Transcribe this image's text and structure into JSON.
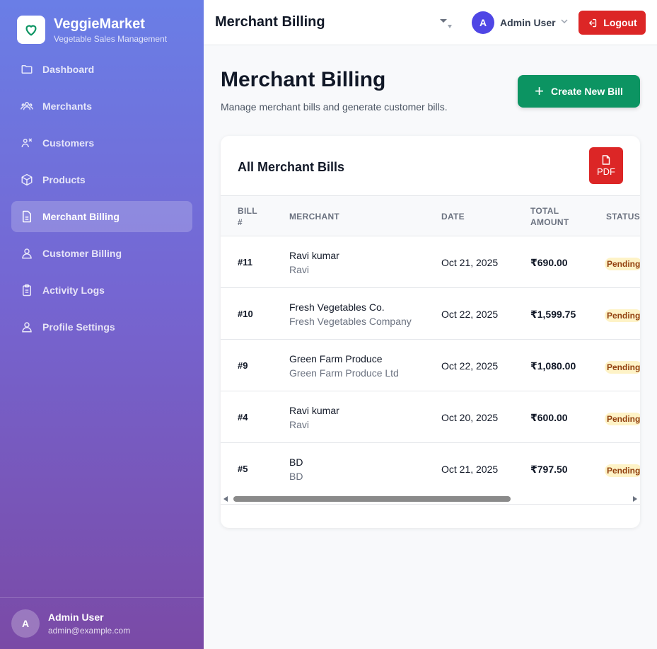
{
  "brand": {
    "name": "VeggieMarket",
    "subtitle": "Vegetable Sales Management"
  },
  "sidebar": {
    "items": [
      {
        "label": "Dashboard",
        "icon": "folder-icon"
      },
      {
        "label": "Merchants",
        "icon": "users-icon"
      },
      {
        "label": "Customers",
        "icon": "user-x-icon"
      },
      {
        "label": "Products",
        "icon": "box-icon"
      },
      {
        "label": "Merchant Billing",
        "icon": "document-icon",
        "active": true
      },
      {
        "label": "Customer Billing",
        "icon": "user-icon"
      },
      {
        "label": "Activity Logs",
        "icon": "clipboard-icon"
      },
      {
        "label": "Profile Settings",
        "icon": "user-icon"
      }
    ],
    "footer": {
      "avatar": "A",
      "name": "Admin User",
      "email": "admin@example.com"
    }
  },
  "topbar": {
    "title": "Merchant Billing",
    "user": {
      "avatar": "A",
      "name": "Admin User"
    },
    "logout_label": "Logout"
  },
  "page": {
    "title": "Merchant Billing",
    "subtitle": "Manage merchant bills and generate customer bills.",
    "create_label": "Create New Bill"
  },
  "table": {
    "title": "All Merchant Bills",
    "pdf_label": "PDF",
    "headers": {
      "bill_1": "BILL",
      "bill_2": "#",
      "merchant": "MERCHANT",
      "date": "DATE",
      "total_1": "TOTAL",
      "total_2": "AMOUNT",
      "status": "STATUS"
    },
    "rows": [
      {
        "bill": "#11",
        "merchant": "Ravi kumar",
        "merchant_sub": "Ravi",
        "date": "Oct 21, 2025",
        "amount": "₹690.00",
        "status": "Pending"
      },
      {
        "bill": "#10",
        "merchant": "Fresh Vegetables Co.",
        "merchant_sub": "Fresh Vegetables Company",
        "date": "Oct 22, 2025",
        "amount": "₹1,599.75",
        "status": "Pending"
      },
      {
        "bill": "#9",
        "merchant": "Green Farm Produce",
        "merchant_sub": "Green Farm Produce Ltd",
        "date": "Oct 22, 2025",
        "amount": "₹1,080.00",
        "status": "Pending"
      },
      {
        "bill": "#4",
        "merchant": "Ravi kumar",
        "merchant_sub": "Ravi",
        "date": "Oct 20, 2025",
        "amount": "₹600.00",
        "status": "Pending"
      },
      {
        "bill": "#5",
        "merchant": "BD",
        "merchant_sub": "BD",
        "date": "Oct 21, 2025",
        "amount": "₹797.50",
        "status": "Pending"
      }
    ]
  },
  "colors": {
    "accent_green": "#0c9462",
    "danger_red": "#dc2626",
    "avatar_indigo": "#4f46e5",
    "pending_bg": "#fef3c7"
  }
}
